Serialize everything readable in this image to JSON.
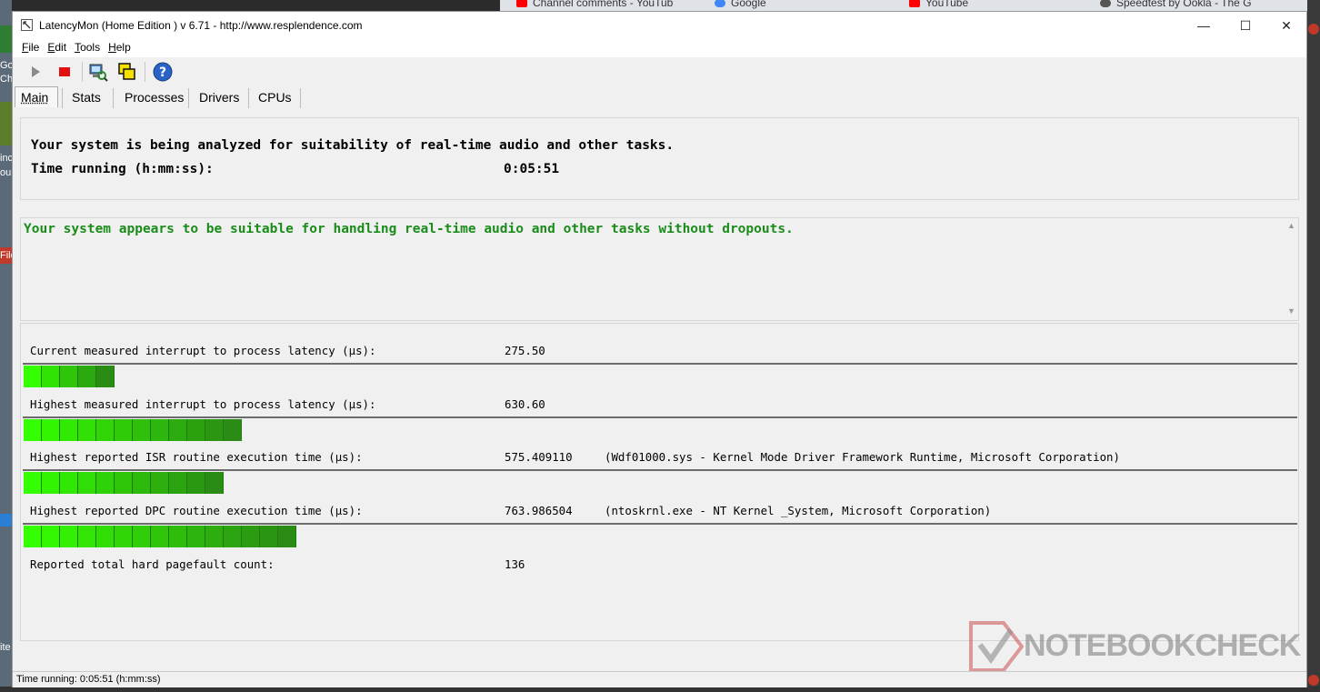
{
  "background": {
    "browser_tabs": [
      {
        "label": "Channel comments - YouTub",
        "icon": "youtube-icon",
        "color": "#ff0000"
      },
      {
        "label": "Google",
        "icon": "google-icon",
        "color": "#4285f4"
      },
      {
        "label": "YouTube",
        "icon": "youtube-icon",
        "color": "#ff0000"
      },
      {
        "label": "Speedtest by Ookla - The G",
        "icon": "speedtest-icon",
        "color": "#333333"
      }
    ],
    "side_texts": [
      "Goo",
      "Chr",
      "inc",
      "our",
      "File",
      "ite"
    ]
  },
  "window": {
    "title": "LatencyMon  (Home Edition )  v 6.71 - http://www.resplendence.com",
    "minimize": "—",
    "maximize": "☐",
    "close": "✕"
  },
  "menu": [
    {
      "key": "F",
      "rest": "ile"
    },
    {
      "key": "E",
      "rest": "dit"
    },
    {
      "key": "T",
      "rest": "ools"
    },
    {
      "key": "H",
      "rest": "elp"
    }
  ],
  "toolbar": {
    "icons": [
      "play-icon",
      "stop-icon",
      "computer-search-icon",
      "windows-icon",
      "help-icon"
    ],
    "help_glyph": "?"
  },
  "tabs": [
    "Main",
    "Stats",
    "Processes",
    "Drivers",
    "CPUs"
  ],
  "main": {
    "analysis_text": "Your system is being analyzed for suitability of real-time audio and other tasks.",
    "time_label": "Time running (h:mm:ss):",
    "time_value": "0:05:51",
    "verdict": "Your system appears to be suitable for handling real-time audio and other tasks without dropouts.",
    "metrics": [
      {
        "label": "Current measured interrupt to process latency (µs):",
        "value": "275.50",
        "detail": "",
        "bar_cells": 5
      },
      {
        "label": "Highest measured interrupt to process latency (µs):",
        "value": "630.60",
        "detail": "",
        "bar_cells": 12
      },
      {
        "label": "Highest reported ISR routine execution time (µs):",
        "value": "575.409110",
        "detail": "(Wdf01000.sys - Kernel Mode Driver Framework Runtime, Microsoft Corporation)",
        "bar_cells": 11
      },
      {
        "label": "Highest reported DPC routine execution time (µs):",
        "value": "763.986504",
        "detail": "(ntoskrnl.exe - NT Kernel _System, Microsoft Corporation)",
        "bar_cells": 15
      }
    ],
    "pagefault_label": "Reported total hard pagefault count:",
    "pagefault_value": "136"
  },
  "statusbar": "Time running: 0:05:51  (h:mm:ss)",
  "watermark": "NOTEBOOKCHECK",
  "colors": {
    "verdict_green": "#1a8c1a",
    "bar_bright": "#33ff00",
    "bar_dark": "#2a8c14"
  }
}
